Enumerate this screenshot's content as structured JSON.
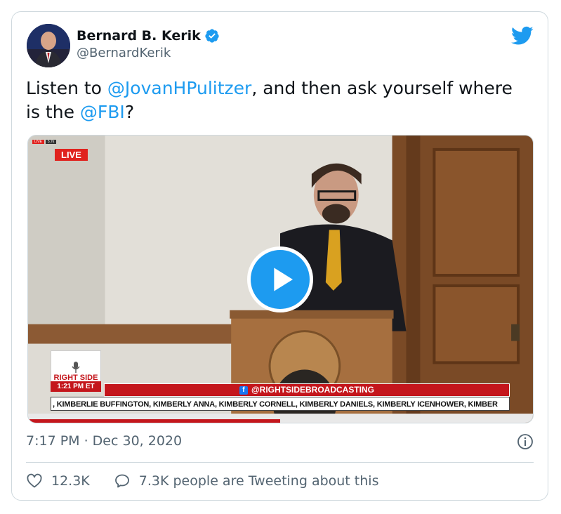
{
  "author": {
    "name": "Bernard B. Kerik",
    "handle": "@BernardKerik",
    "verified": true
  },
  "tweet": {
    "text_parts": [
      {
        "text": "Listen to ",
        "type": "plain"
      },
      {
        "text": "@JovanHPulitzer",
        "type": "mention"
      },
      {
        "text": ", and then ask yourself where is the ",
        "type": "plain"
      },
      {
        "text": "@FBI",
        "type": "mention"
      },
      {
        "text": "?",
        "type": "plain"
      }
    ]
  },
  "video": {
    "live_badge": "LIVE",
    "mini_live": "LIVE",
    "mini_count": "5.7k",
    "logo_text": "RIGHT SIDE",
    "time_label": "1:21 PM ET",
    "banner": "@RIGHTSIDEBROADCASTING",
    "ticker": ", KIMBERLIE BUFFINGTON, KIMBERLY ANNA, KIMBERLY CORNELL, KIMBERLY DANIELS, KIMBERLY ICENHOWER, KIMBER"
  },
  "meta": {
    "timestamp": "7:17 PM · Dec 30, 2020"
  },
  "stats": {
    "likes": "12.3K",
    "tweeting": "7.3K people are Tweeting about this"
  },
  "colors": {
    "accent": "#1d9bf0",
    "text": "#0f1419",
    "muted": "#536471",
    "border": "#cfd9de",
    "broadcast_red": "#c4161c"
  },
  "icons": [
    "verified-badge-icon",
    "twitter-bird-icon",
    "play-icon",
    "info-icon",
    "heart-icon",
    "speech-bubble-icon",
    "facebook-icon"
  ]
}
